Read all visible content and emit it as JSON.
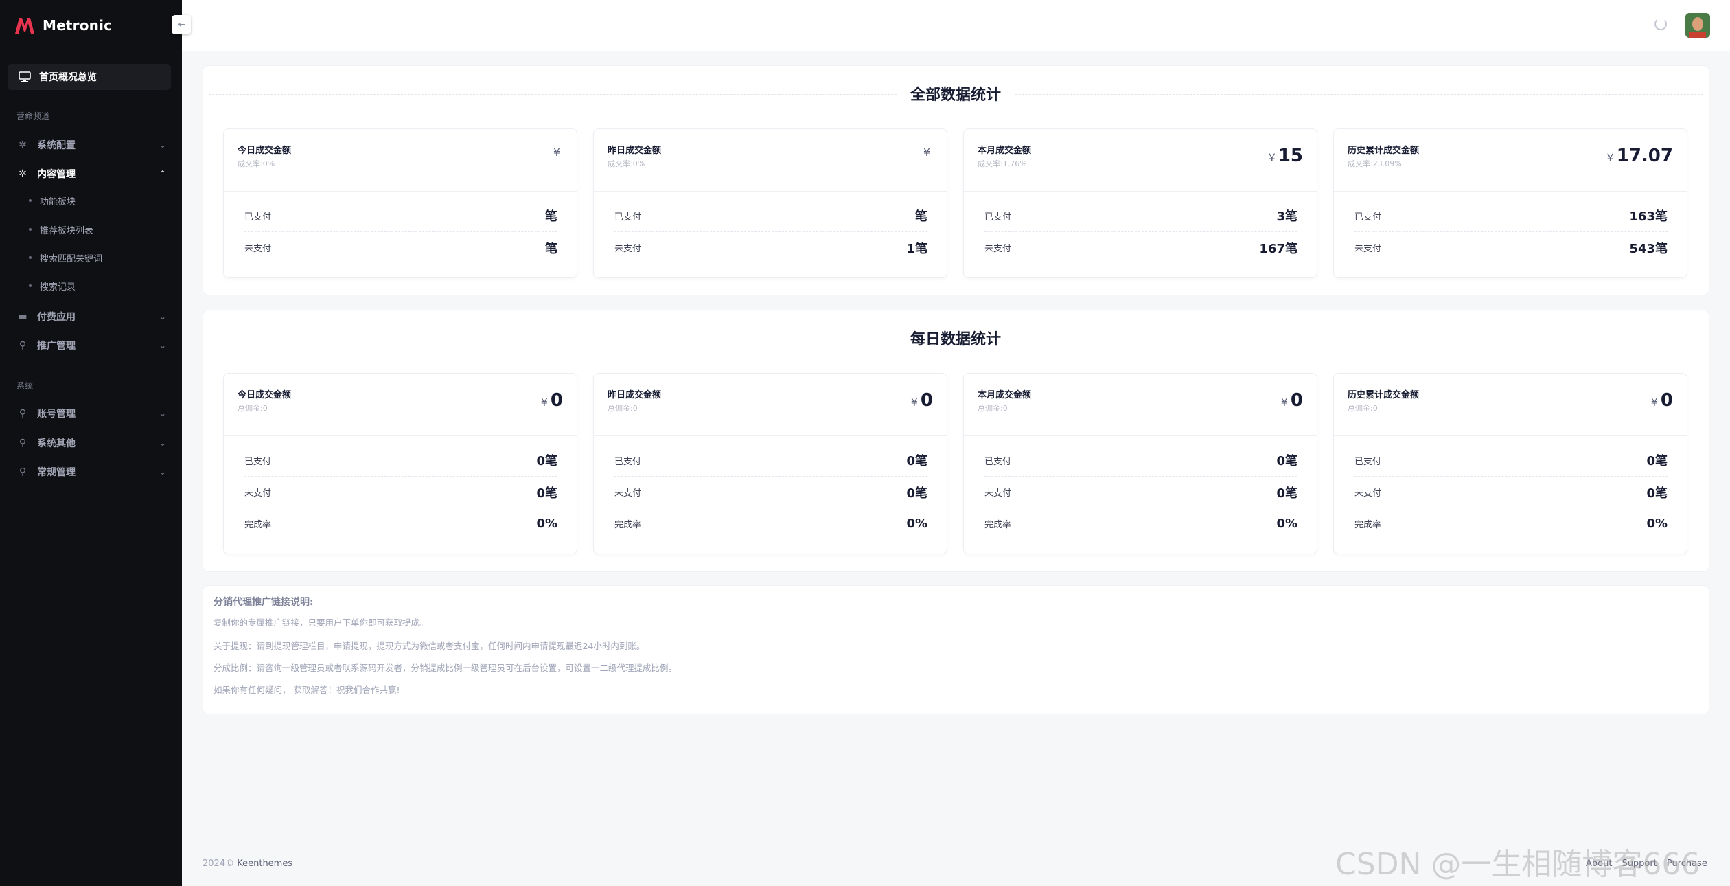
{
  "app": {
    "name": "Metronic",
    "brand_color": "#e8344e"
  },
  "sidebar": {
    "active": {
      "label": "首页概况总览",
      "icon": "monitor-icon"
    },
    "sections": [
      {
        "label": "营命频道"
      },
      {
        "label": "系统"
      }
    ],
    "items": [
      {
        "label": "系统配置",
        "icon": "gear-icon"
      },
      {
        "label": "内容管理",
        "icon": "gear-icon"
      },
      {
        "label": "付费应用",
        "icon": "wallet-icon"
      },
      {
        "label": "推广管理",
        "icon": "link-icon"
      },
      {
        "label": "账号管理",
        "icon": "link-icon"
      },
      {
        "label": "系统其他",
        "icon": "link-icon"
      },
      {
        "label": "常规管理",
        "icon": "link-icon"
      }
    ],
    "subitems": [
      {
        "label": "功能板块"
      },
      {
        "label": "推荐板块列表"
      },
      {
        "label": "搜索匹配关键词"
      },
      {
        "label": "搜索记录"
      }
    ]
  },
  "all_stats": {
    "title": "全部数据统计",
    "cards": [
      {
        "title": "今日成交金额",
        "sub": "成交率:0%",
        "yen": "¥",
        "value": "",
        "rows": [
          {
            "label": "已支付",
            "value": "笔"
          },
          {
            "label": "未支付",
            "value": "笔"
          }
        ]
      },
      {
        "title": "昨日成交金额",
        "sub": "成交率:0%",
        "yen": "¥",
        "value": "",
        "rows": [
          {
            "label": "已支付",
            "value": "笔"
          },
          {
            "label": "未支付",
            "value": "1笔"
          }
        ]
      },
      {
        "title": "本月成交金额",
        "sub": "成交率:1.76%",
        "yen": "¥",
        "value": "15",
        "rows": [
          {
            "label": "已支付",
            "value": "3笔"
          },
          {
            "label": "未支付",
            "value": "167笔"
          }
        ]
      },
      {
        "title": "历史累计成交金额",
        "sub": "成交率:23.09%",
        "yen": "¥",
        "value": "17.07",
        "rows": [
          {
            "label": "已支付",
            "value": "163笔"
          },
          {
            "label": "未支付",
            "value": "543笔"
          }
        ]
      }
    ]
  },
  "daily_stats": {
    "title": "每日数据统计",
    "cards": [
      {
        "title": "今日成交金额",
        "sub": "总佣金:0",
        "yen": "¥",
        "value": "0",
        "rows": [
          {
            "label": "已支付",
            "value": "0笔"
          },
          {
            "label": "未支付",
            "value": "0笔"
          },
          {
            "label": "完成率",
            "value": "0%"
          }
        ]
      },
      {
        "title": "昨日成交金额",
        "sub": "总佣金:0",
        "yen": "¥",
        "value": "0",
        "rows": [
          {
            "label": "已支付",
            "value": "0笔"
          },
          {
            "label": "未支付",
            "value": "0笔"
          },
          {
            "label": "完成率",
            "value": "0%"
          }
        ]
      },
      {
        "title": "本月成交金额",
        "sub": "总佣金:0",
        "yen": "¥",
        "value": "0",
        "rows": [
          {
            "label": "已支付",
            "value": "0笔"
          },
          {
            "label": "未支付",
            "value": "0笔"
          },
          {
            "label": "完成率",
            "value": "0%"
          }
        ]
      },
      {
        "title": "历史累计成交金额",
        "sub": "总佣金:0",
        "yen": "¥",
        "value": "0",
        "rows": [
          {
            "label": "已支付",
            "value": "0笔"
          },
          {
            "label": "未支付",
            "value": "0笔"
          },
          {
            "label": "完成率",
            "value": "0%"
          }
        ]
      }
    ]
  },
  "notes": {
    "title": "分销代理推广链接说明:",
    "lines": [
      "复制你的专属推广链接，只要用户下单你即可获取提成。",
      "关于提现：请到提现管理栏目，申请提现，提现方式为微信或者支付宝，任何时间内申请提现最迟24小时内到账。",
      "分成比例：请咨询一级管理员或者联系源码开发者，分销提成比例一级管理员可在后台设置，可设置一二级代理提成比例。",
      "如果你有任何疑问， 获取解答！祝我们合作共赢!"
    ]
  },
  "footer": {
    "copyright": "2024©",
    "company": "Keenthemes",
    "links": [
      "About",
      "Support",
      "Purchase"
    ]
  },
  "watermark": "CSDN @一生相随博客666"
}
